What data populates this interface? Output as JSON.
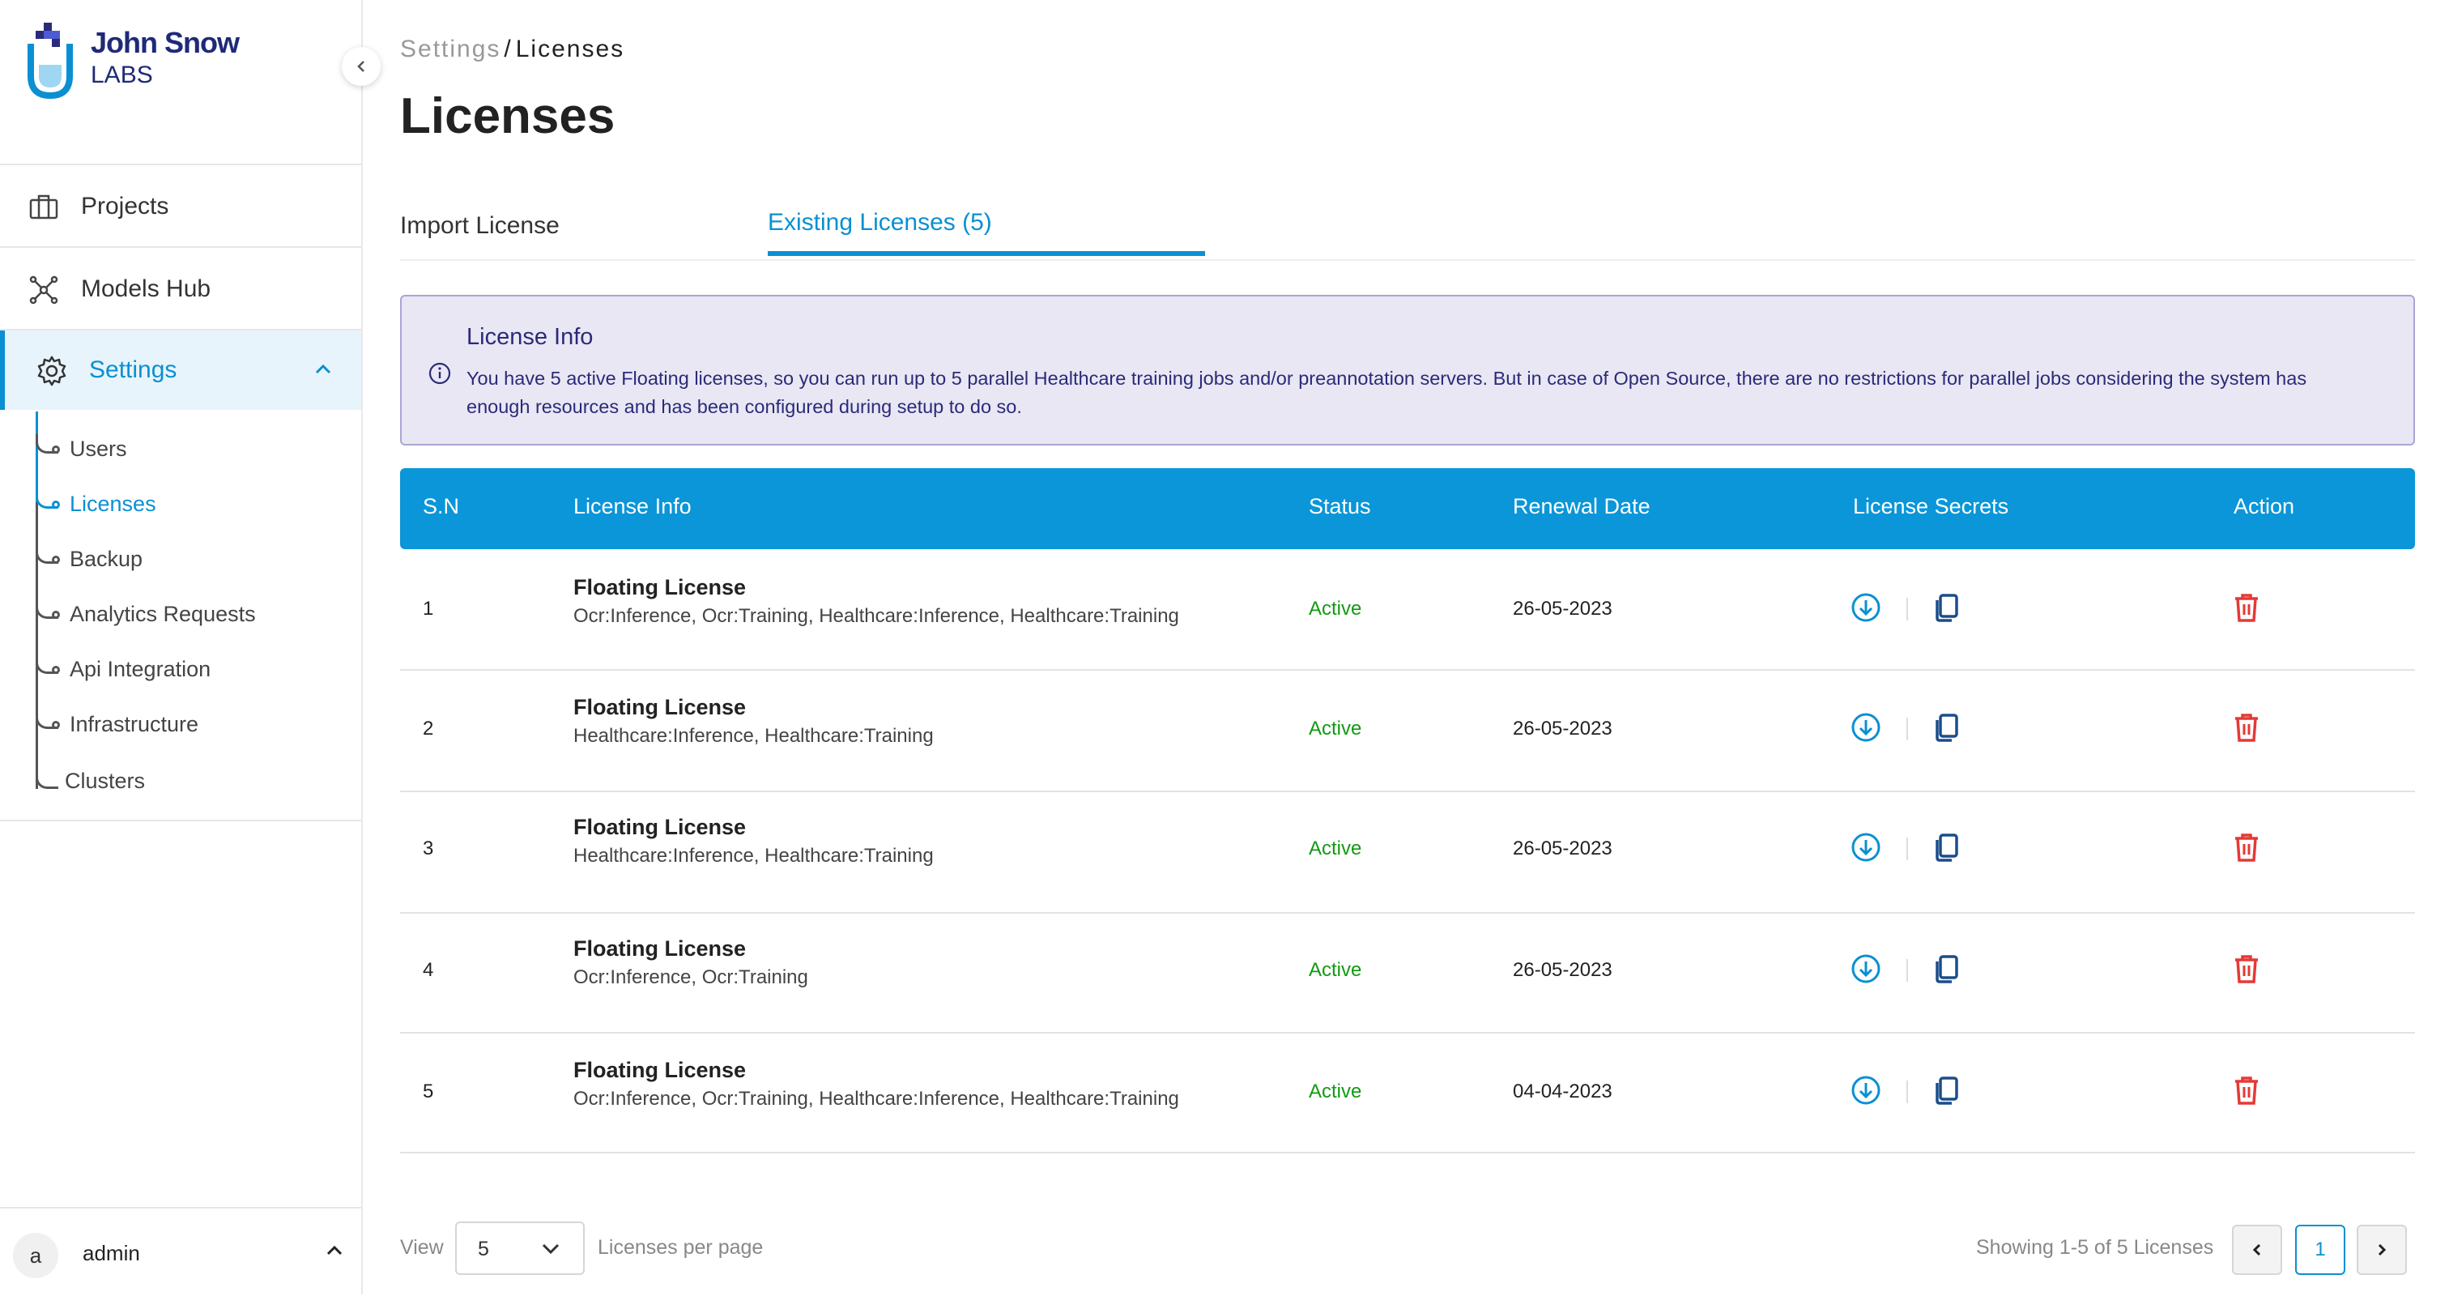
{
  "brand": {
    "line1": "John Snow",
    "line2": "LABS"
  },
  "sidebar": {
    "items": [
      {
        "label": "Projects",
        "icon": "briefcase-icon"
      },
      {
        "label": "Models Hub",
        "icon": "network-icon"
      },
      {
        "label": "Settings",
        "icon": "gear-icon"
      }
    ],
    "sub_items": [
      "Users",
      "Licenses",
      "Backup",
      "Analytics Requests",
      "Api Integration",
      "Infrastructure",
      "Clusters"
    ],
    "active_sub": "Licenses"
  },
  "user": {
    "avatar_letter": "a",
    "name": "admin"
  },
  "breadcrumb": {
    "parent": "Settings",
    "separator": "/",
    "current": "Licenses"
  },
  "page_title": "Licenses",
  "tabs": [
    {
      "label": "Import License"
    },
    {
      "label": "Existing Licenses  (5)"
    }
  ],
  "info": {
    "title": "License Info",
    "text": "You have 5 active Floating licenses, so you can run up to 5 parallel Healthcare training jobs and/or preannotation servers. But in case of Open Source, there are no restrictions for parallel jobs considering the system has enough resources and has been configured during setup to do so."
  },
  "table": {
    "headers": [
      "S.N",
      "License Info",
      "Status",
      "Renewal Date",
      "License Secrets",
      "Action"
    ],
    "rows": [
      {
        "sn": "1",
        "title": "Floating License",
        "scopes": "Ocr:Inference, Ocr:Training, Healthcare:Inference, Healthcare:Training",
        "status": "Active",
        "renewal": "26-05-2023"
      },
      {
        "sn": "2",
        "title": "Floating License",
        "scopes": "Healthcare:Inference, Healthcare:Training",
        "status": "Active",
        "renewal": "26-05-2023"
      },
      {
        "sn": "3",
        "title": "Floating License",
        "scopes": "Healthcare:Inference, Healthcare:Training",
        "status": "Active",
        "renewal": "26-05-2023"
      },
      {
        "sn": "4",
        "title": "Floating License",
        "scopes": "Ocr:Inference, Ocr:Training",
        "status": "Active",
        "renewal": "26-05-2023"
      },
      {
        "sn": "5",
        "title": "Floating License",
        "scopes": "Ocr:Inference, Ocr:Training, Healthcare:Inference, Healthcare:Training",
        "status": "Active",
        "renewal": "04-04-2023"
      }
    ]
  },
  "footer": {
    "view_label": "View",
    "per_page_value": "5",
    "per_page_label": "Licenses per page",
    "showing": "Showing 1-5 of 5 Licenses",
    "current_page": "1"
  },
  "colors": {
    "accent": "#0a90d2",
    "header_bg": "#0a96d8",
    "active_status": "#129a12",
    "delete": "#e53935",
    "info_bg": "#e8e7f3"
  }
}
